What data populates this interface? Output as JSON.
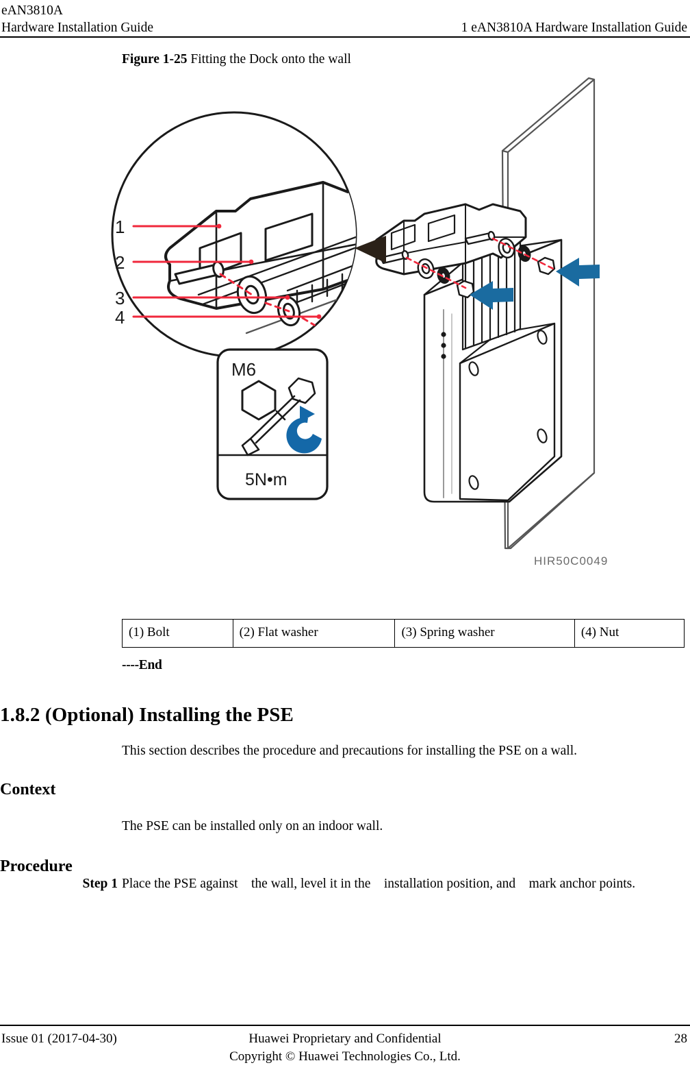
{
  "header": {
    "left_line1": "eAN3810A",
    "left_line2": "Hardware Installation Guide",
    "right": "1 eAN3810A Hardware Installation Guide"
  },
  "figure": {
    "number": "Figure 1-25",
    "caption": "Fitting the Dock onto the wall",
    "art_id": "HIR50C0049",
    "torque_box": {
      "thread": "M6",
      "torque": "5N•m",
      "rotation_icon": "clockwise-arrow-icon",
      "tool_icon": "torque-wrench-icon",
      "head_icon": "hex-head-icon"
    },
    "callout_numbers": [
      "1",
      "2",
      "3",
      "4"
    ],
    "colors": {
      "accent_blue": "#1a6ba0",
      "callout_red": "#f0283c",
      "line_black": "#1a1a1a"
    }
  },
  "legend": {
    "cells": [
      "(1) Bolt",
      "(2) Flat washer",
      "(3) Spring washer",
      "(4) Nut"
    ]
  },
  "end_marker": "----End",
  "section": {
    "heading": "1.8.2 (Optional) Installing the PSE",
    "intro": "This section describes the procedure and precautions for installing the PSE on a wall.",
    "context_heading": "Context",
    "context_text": "The PSE can be installed only on an indoor wall.",
    "procedure_heading": "Procedure",
    "step_label": "Step 1",
    "step_text": "Place the PSE against the wall, level it in the installation position, and mark anchor points."
  },
  "footer": {
    "issue": "Issue 01 (2017-04-30)",
    "confidential": "Huawei Proprietary and Confidential",
    "copyright": "Copyright © Huawei Technologies Co., Ltd.",
    "page_number": "28"
  }
}
